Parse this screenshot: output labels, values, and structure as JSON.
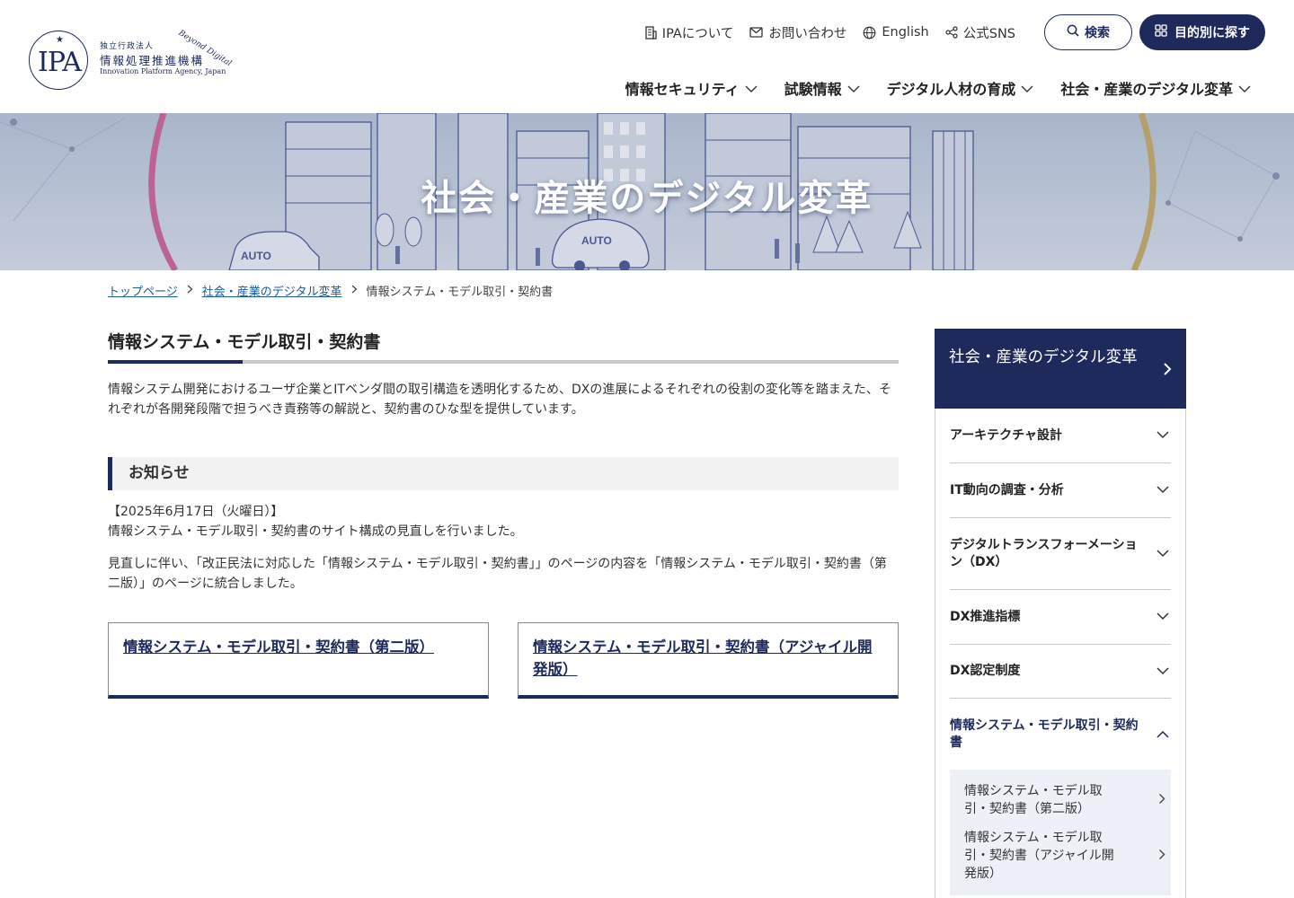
{
  "logo": {
    "mark": "IPA",
    "sub": "独立行政法人",
    "name": "情報処理推進機構",
    "en": "Innovation Platform Agency, Japan",
    "tagline": "Beyond Digital"
  },
  "util_nav": [
    {
      "label": "IPAについて",
      "icon": "building-icon"
    },
    {
      "label": "お問い合わせ",
      "icon": "mail-icon"
    },
    {
      "label": "English",
      "icon": "globe-icon"
    },
    {
      "label": "公式SNS",
      "icon": "share-icon"
    }
  ],
  "search_label": "検索",
  "purpose_label": "目的別に探す",
  "main_nav": [
    {
      "label": "情報セキュリティ"
    },
    {
      "label": "試験情報"
    },
    {
      "label": "デジタル人材の育成"
    },
    {
      "label": "社会・産業のデジタル変革"
    }
  ],
  "hero": {
    "title": "社会・産業のデジタル変革",
    "car_label_1": "AUTO",
    "car_label_2": "AUTO"
  },
  "breadcrumb": [
    {
      "label": "トップページ"
    },
    {
      "label": "社会・産業のデジタル変革"
    },
    {
      "label": "情報システム・モデル取引・契約書"
    }
  ],
  "page": {
    "title": "情報システム・モデル取引・契約書",
    "intro": "情報システム開発におけるユーザ企業とITベンダ間の取引構造を透明化するため、DXの進展によるそれぞれの役割の変化等を踏まえた、それぞれが各開発段階で担うべき責務等の解説と、契約書のひな型を提供しています。"
  },
  "notice": {
    "heading": "お知らせ",
    "date": "【2025年6月17日（火曜日）】",
    "line1": "情報システム・モデル取引・契約書のサイト構成の見直しを行いました。",
    "line2": "見直しに伴い、「改正民法に対応した「情報システム・モデル取引・契約書」」のページの内容を「情報システム・モデル取引・契約書（第二版）」のページに統合しました。"
  },
  "cards": [
    {
      "label": "情報システム・モデル取引・契約書（第二版）"
    },
    {
      "label": "情報システム・モデル取引・契約書（アジャイル開発版）"
    }
  ],
  "sidebar": {
    "heading": "社会・産業のデジタル変革",
    "items": [
      {
        "label": "アーキテクチャ設計"
      },
      {
        "label": "IT動向の調査・分析"
      },
      {
        "label": "デジタルトランスフォーメーション（DX）"
      },
      {
        "label": "DX推進指標"
      },
      {
        "label": "DX認定制度"
      },
      {
        "label": "情報システム・モデル取引・契約書"
      }
    ],
    "sub_items": [
      {
        "label": "情報システム・モデル取引・契約書（第二版）"
      },
      {
        "label": "情報システム・モデル取引・契約書（アジャイル開発版）"
      }
    ]
  },
  "colors": {
    "brand_navy": "#1f2a5c",
    "link_blue": "#1a5b9c",
    "notice_bg": "#f2f2f2",
    "sub_bg": "#eef0f8"
  }
}
